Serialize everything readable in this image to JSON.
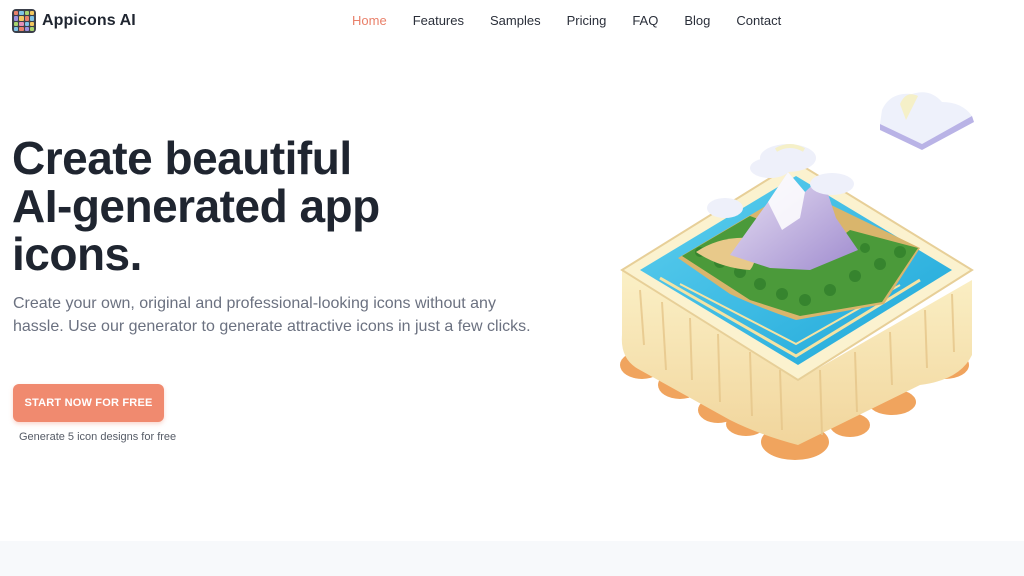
{
  "brand": {
    "name": "Appicons AI"
  },
  "nav": {
    "items": [
      {
        "label": "Home",
        "active": true
      },
      {
        "label": "Features"
      },
      {
        "label": "Samples"
      },
      {
        "label": "Pricing"
      },
      {
        "label": "FAQ"
      },
      {
        "label": "Blog"
      },
      {
        "label": "Contact"
      }
    ]
  },
  "hero": {
    "title_line1": "Create beautiful",
    "title_line2": "AI-generated app",
    "title_line3": "icons.",
    "subtitle": "Create your own, original and professional-looking icons without any hassle. Use our generator to generate attractive icons in just a few clicks.",
    "cta_label": "START NOW FOR FREE",
    "cta_note": "Generate 5 icon designs for free"
  },
  "colors": {
    "accent": "#f08a6f",
    "nav_active": "#e9806a",
    "title": "#1f2530",
    "subtitle": "#6b7180"
  },
  "illustration": {
    "icon": "floating-island-mountain-icon"
  }
}
